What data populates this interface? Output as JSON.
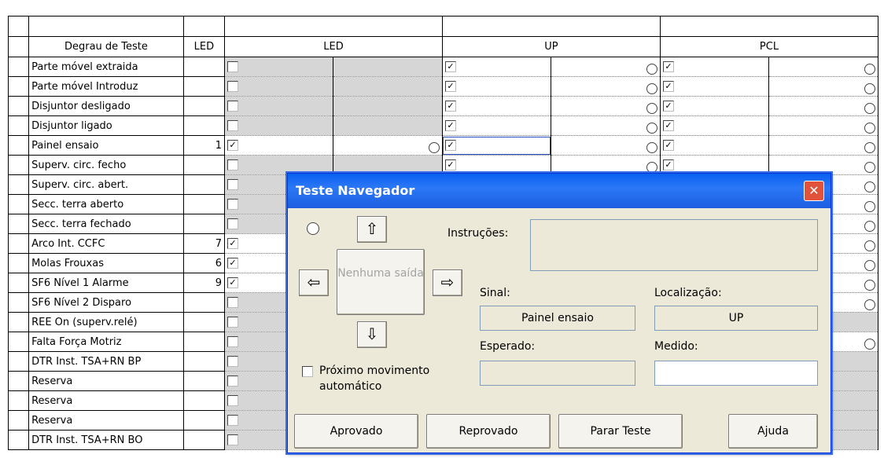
{
  "sheet": {
    "headers": {
      "step": "Degrau de Teste",
      "led_col": "LED",
      "group_led": "LED",
      "group_up": "UP",
      "group_pcl": "PCL"
    },
    "rows": [
      {
        "name": "Parte móvel extraida",
        "num": "",
        "led": false,
        "up": true,
        "pcl": true
      },
      {
        "name": "Parte móvel Introduz",
        "num": "",
        "led": false,
        "up": true,
        "pcl": true
      },
      {
        "name": "Disjuntor desligado",
        "num": "",
        "led": false,
        "up": true,
        "pcl": true
      },
      {
        "name": "Disjuntor ligado",
        "num": "",
        "led": false,
        "up": true,
        "pcl": true
      },
      {
        "name": "Painel ensaio",
        "num": "1",
        "led": true,
        "up": true,
        "pcl": true
      },
      {
        "name": "Superv. circ. fecho",
        "num": "",
        "led": false,
        "up": true,
        "pcl": true
      },
      {
        "name": "Superv. circ. abert.",
        "num": "",
        "led": false,
        "up": true,
        "pcl": true
      },
      {
        "name": "Secc. terra aberto",
        "num": "",
        "led": false,
        "up": true,
        "pcl": true
      },
      {
        "name": "Secc. terra fechado",
        "num": "",
        "led": false,
        "up": true,
        "pcl": true
      },
      {
        "name": "Arco Int. CCFC",
        "num": "7",
        "led": true,
        "up": true,
        "pcl": true
      },
      {
        "name": "Molas Frouxas",
        "num": "6",
        "led": true,
        "up": true,
        "pcl": true
      },
      {
        "name": "SF6 Nível 1 Alarme",
        "num": "9",
        "led": true,
        "up": true,
        "pcl": true
      },
      {
        "name": "SF6 Nível 2 Disparo",
        "num": "",
        "led": false,
        "up": true,
        "pcl": true
      },
      {
        "name": "REE On (superv.relé)",
        "num": "",
        "led": false,
        "up": true,
        "pcl": false
      },
      {
        "name": "Falta Força Motriz",
        "num": "",
        "led": false,
        "up": true,
        "pcl": true
      },
      {
        "name": "DTR Inst. TSA+RN BP",
        "num": "",
        "led": false,
        "up": true,
        "pcl": false
      },
      {
        "name": "Reserva",
        "num": "",
        "led": false,
        "up": true,
        "pcl": false
      },
      {
        "name": "Reserva",
        "num": "",
        "led": false,
        "up": true,
        "pcl": false
      },
      {
        "name": "Reserva",
        "num": "",
        "led": false,
        "up": true,
        "pcl": false
      },
      {
        "name": "DTR Inst. TSA+RN BO",
        "num": "",
        "led": false,
        "up": true,
        "pcl": false
      }
    ]
  },
  "dialog": {
    "title": "Teste Navegador",
    "close_icon": "close-icon",
    "no_output": "Nenhuma saída",
    "auto_move_label": "Próximo movimento automático",
    "auto_move_checked": false,
    "instructions_label": "Instruções:",
    "instructions_value": "",
    "signal_label": "Sinal:",
    "signal_value": "Painel ensaio",
    "location_label": "Localização:",
    "location_value": "UP",
    "expected_label": "Esperado:",
    "expected_value": "",
    "measured_label": "Medido:",
    "measured_value": "",
    "buttons": {
      "approved": "Aprovado",
      "rejected": "Reprovado",
      "stop": "Parar Teste",
      "help": "Ajuda"
    },
    "arrows": {
      "up": "⇧",
      "down": "⇩",
      "left": "⇦",
      "right": "⇨"
    }
  }
}
